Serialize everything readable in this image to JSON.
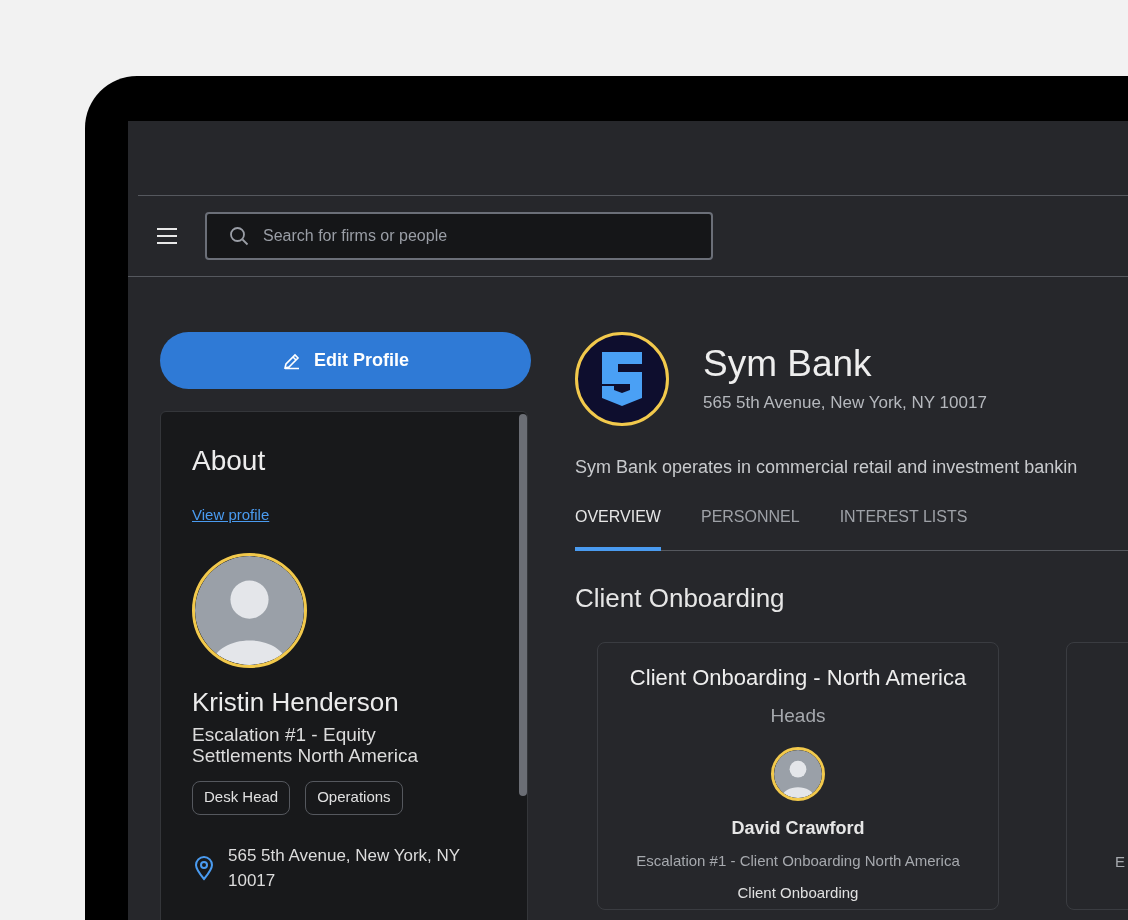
{
  "search": {
    "placeholder": "Search for firms or people"
  },
  "sidebar": {
    "edit_button": "Edit Profile",
    "about": {
      "title": "About",
      "link": "View profile",
      "name": "Kristin Henderson",
      "role": "Escalation #1 - Equity Settlements North America",
      "tags": [
        "Desk Head",
        "Operations"
      ],
      "address": "565 5th Avenue, New York, NY 10017"
    }
  },
  "firm": {
    "name": "Sym Bank",
    "address": "565 5th Avenue, New York, NY 10017",
    "description": "Sym Bank operates in commercial retail and investment bankin"
  },
  "tabs": [
    {
      "label": "OVERVIEW",
      "selected": true
    },
    {
      "label": "PERSONNEL",
      "selected": false
    },
    {
      "label": "INTEREST LISTS",
      "selected": false
    }
  ],
  "section": {
    "title": "Client Onboarding",
    "cards": [
      {
        "title": "Client Onboarding - North America",
        "subtitle": "Heads",
        "person": "David Crawford",
        "role": "Escalation #1 - Client Onboarding North America",
        "team": "Client Onboarding"
      },
      {
        "role": "E"
      }
    ]
  }
}
